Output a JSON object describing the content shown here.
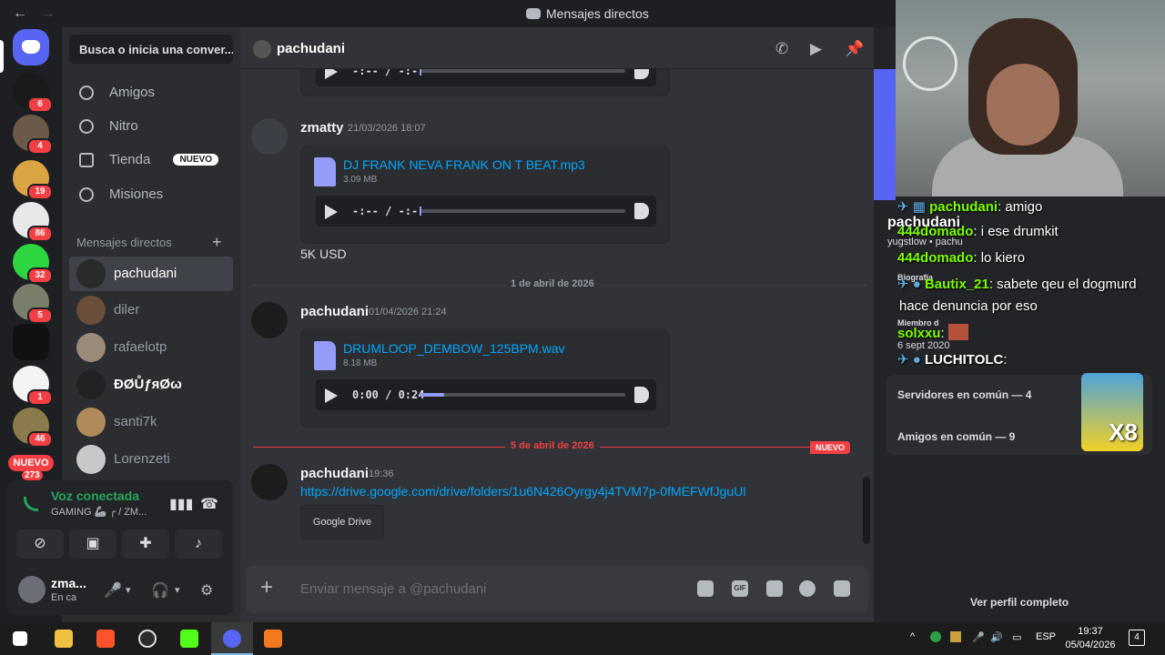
{
  "titlebar": {
    "title": "Mensajes directos",
    "back": "←",
    "forward": "→"
  },
  "guilds": {
    "badges": [
      "6",
      "4",
      "19",
      "86",
      "32",
      "5",
      "",
      "1",
      "46"
    ],
    "nuevo_label": "NUEVO",
    "nuevo_count": "273"
  },
  "sidebar": {
    "search_placeholder": "Busca o inicia una conver...",
    "nav": [
      {
        "label": "Amigos"
      },
      {
        "label": "Nitro"
      },
      {
        "label": "Tienda",
        "tag": "NUEVO"
      },
      {
        "label": "Misiones"
      }
    ],
    "dm_header": "Mensajes directos",
    "dms": [
      {
        "name": "pachudani"
      },
      {
        "name": "diler"
      },
      {
        "name": "rafaelotp"
      },
      {
        "name": "ÐØŮƒяØω"
      },
      {
        "name": "santi7k"
      },
      {
        "name": "Lorenzeti"
      }
    ]
  },
  "voice": {
    "status": "Voz conectada",
    "channel": "GAMING 🦾 ╭ / ZM..."
  },
  "user": {
    "name": "zma...",
    "status": "En ca"
  },
  "chat_header": {
    "name": "pachudani"
  },
  "messages": {
    "top_player_time": "-:-- / -:--",
    "m1": {
      "author": "zmatty",
      "time": "21/03/2026 18:07",
      "file": "DJ FRANK NEVA FRANK ON T BEAT.mp3",
      "size": "3.09 MB",
      "player_time": "-:-- / -:--",
      "progress": 0,
      "text": "5K USD"
    },
    "divider1": "1 de abril de 2026",
    "m2": {
      "author": "pachudani",
      "time": "01/04/2026 21:24",
      "file": "DRUMLOOP_DEMBOW_125BPM.wav",
      "size": "8.18 MB",
      "player_time": "0:00 / 0:24",
      "progress": 0.12
    },
    "divider2": "5 de abril de 2026",
    "new_tag": "NUEVO",
    "m3": {
      "author": "pachudani",
      "time": "19:36",
      "link": "https://drive.google.com/drive/folders/1u6N426Oyrgy4j4TVM7p-0fMEFWfJguUl",
      "embed": "Google Drive"
    }
  },
  "composer": {
    "placeholder": "Enviar mensaje a @pachudani",
    "gif": "GIF"
  },
  "overlay": {
    "lines": [
      {
        "user": "pachudani",
        "msg": ": amigo",
        "color": "#7cfc00"
      },
      {
        "user": "444domado",
        "msg": ": i ese drumkit",
        "color": "#7cfc00"
      },
      {
        "user": "444domado",
        "msg": ": lo kiero",
        "color": "#7cfc00"
      },
      {
        "user": "Bautix_21",
        "msg": ": sabete qeu el dogmurd",
        "color": "#7cfc00"
      },
      {
        "user": "",
        "msg": "hace denuncia por eso",
        "color": "#ffffff"
      },
      {
        "user": "solxxu",
        "msg": ":",
        "color": "#7cfc00"
      },
      {
        "user": "LUCHITOLC",
        "msg": ":",
        "color": "#ffffff"
      }
    ],
    "profile_name": "pachudani",
    "profile_sub": "yugstlow • pachu",
    "bio_label": "Biografía",
    "member_label": "Miembro d",
    "member_date": "6 sept 2020"
  },
  "profile": {
    "servers": "Servidores en común — 4",
    "friends": "Amigos en común — 9",
    "view_full": "Ver perfil completo",
    "sticker_text": "X8"
  },
  "taskbar": {
    "lang": "ESP",
    "time": "19:37",
    "date": "05/04/2026",
    "notif": "4"
  }
}
